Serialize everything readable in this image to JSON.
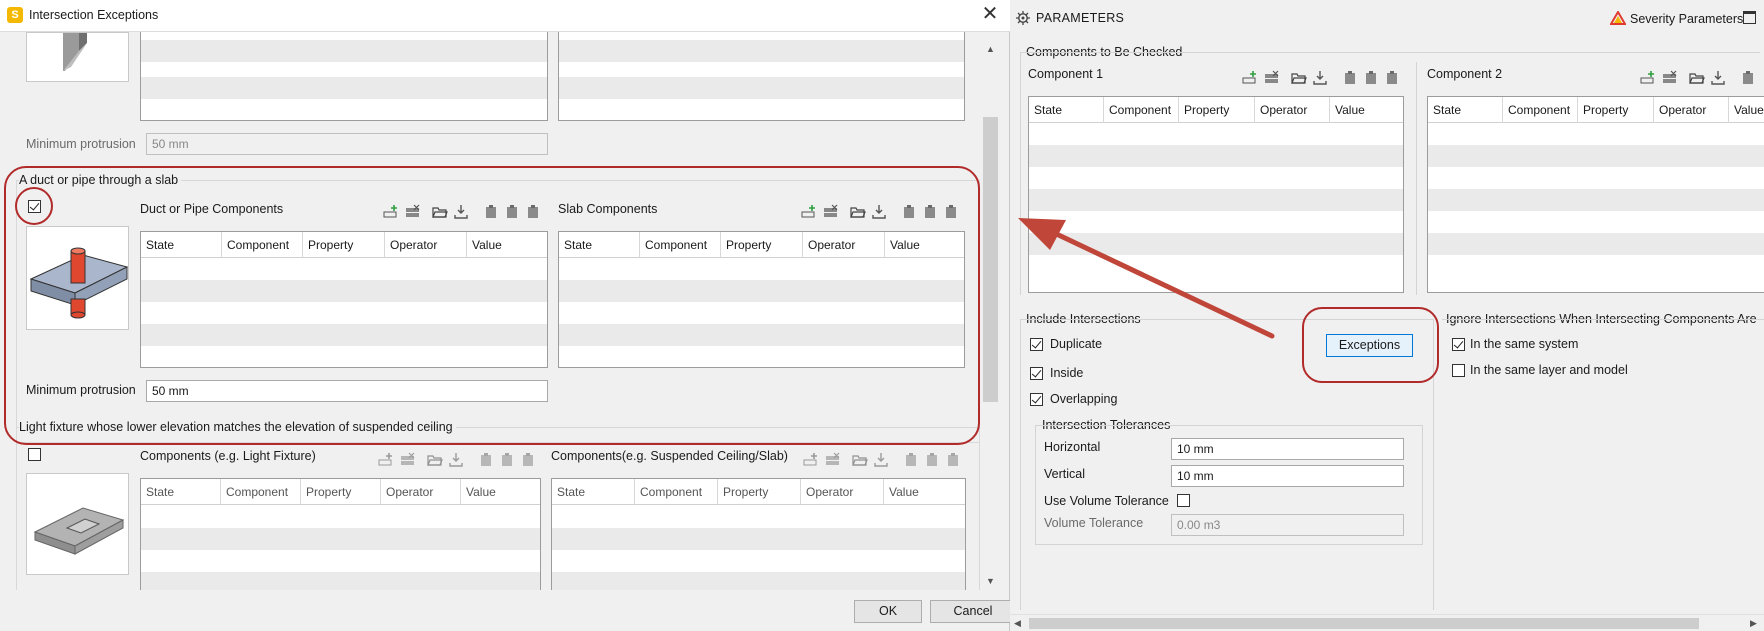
{
  "dialog": {
    "title": "Intersection Exceptions",
    "app_logo": "S",
    "close_glyph": "✕",
    "ok_label": "OK",
    "cancel_label": "Cancel"
  },
  "columns": [
    "State",
    "Component",
    "Property",
    "Operator",
    "Value"
  ],
  "sections": {
    "top_partial": {
      "min_protrusion_label": "Minimum protrusion",
      "min_protrusion_value": "50 mm"
    },
    "duct_slab": {
      "title": "A duct or pipe through a slab",
      "checked": true,
      "left_grid_label": "Duct or Pipe Components",
      "right_grid_label": "Slab Components",
      "min_protrusion_label": "Minimum protrusion",
      "min_protrusion_value": "50 mm"
    },
    "light_fixture": {
      "title": "Light fixture whose lower elevation matches the elevation of suspended ceiling",
      "checked": false,
      "left_grid_label": "Components (e.g. Light Fixture)",
      "right_grid_label": "Components(e.g. Suspended Ceiling/Slab)"
    }
  },
  "params": {
    "header_title": "PARAMETERS",
    "severity_label": "Severity Parameters",
    "components_section": "Components to Be Checked",
    "component1_label": "Component 1",
    "component2_label": "Component 2",
    "include_title": "Include Intersections",
    "include_items": [
      {
        "label": "Duplicate",
        "checked": true
      },
      {
        "label": "Inside",
        "checked": true
      },
      {
        "label": "Overlapping",
        "checked": true
      }
    ],
    "exceptions_label": "Exceptions",
    "tolerances_title": "Intersection Tolerances",
    "horizontal_label": "Horizontal",
    "horizontal_value": "10 mm",
    "vertical_label": "Vertical",
    "vertical_value": "10 mm",
    "use_volume_label": "Use Volume Tolerance",
    "use_volume_checked": false,
    "volume_label": "Volume Tolerance",
    "volume_value": "0.00 m3",
    "ignore_title": "Ignore Intersections When Intersecting Components Are",
    "ignore_items": [
      {
        "label": "In the same system",
        "checked": true
      },
      {
        "label": "In the same layer and model",
        "checked": false
      }
    ]
  },
  "colors": {
    "highlight": "#b12b2b",
    "arrow": "#c0463a",
    "accent": "#0078d7",
    "pipe": "#e0472f",
    "slab": "#8898b0"
  },
  "icons": [
    "add-row-icon",
    "remove-row-icon",
    "open-folder-icon",
    "import-icon",
    "clipboard-icon",
    "gear-icon",
    "severity-triangle-icon",
    "maximize-icon"
  ]
}
